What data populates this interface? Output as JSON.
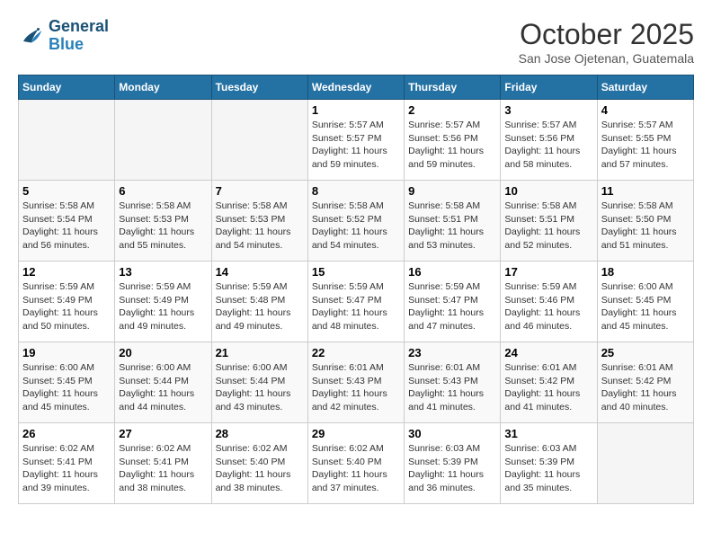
{
  "logo": {
    "line1": "General",
    "line2": "Blue"
  },
  "title": "October 2025",
  "location": "San Jose Ojetenan, Guatemala",
  "weekdays": [
    "Sunday",
    "Monday",
    "Tuesday",
    "Wednesday",
    "Thursday",
    "Friday",
    "Saturday"
  ],
  "weeks": [
    [
      {
        "day": "",
        "sunrise": "",
        "sunset": "",
        "daylight": ""
      },
      {
        "day": "",
        "sunrise": "",
        "sunset": "",
        "daylight": ""
      },
      {
        "day": "",
        "sunrise": "",
        "sunset": "",
        "daylight": ""
      },
      {
        "day": "1",
        "sunrise": "Sunrise: 5:57 AM",
        "sunset": "Sunset: 5:57 PM",
        "daylight": "Daylight: 11 hours and 59 minutes."
      },
      {
        "day": "2",
        "sunrise": "Sunrise: 5:57 AM",
        "sunset": "Sunset: 5:56 PM",
        "daylight": "Daylight: 11 hours and 59 minutes."
      },
      {
        "day": "3",
        "sunrise": "Sunrise: 5:57 AM",
        "sunset": "Sunset: 5:56 PM",
        "daylight": "Daylight: 11 hours and 58 minutes."
      },
      {
        "day": "4",
        "sunrise": "Sunrise: 5:57 AM",
        "sunset": "Sunset: 5:55 PM",
        "daylight": "Daylight: 11 hours and 57 minutes."
      }
    ],
    [
      {
        "day": "5",
        "sunrise": "Sunrise: 5:58 AM",
        "sunset": "Sunset: 5:54 PM",
        "daylight": "Daylight: 11 hours and 56 minutes."
      },
      {
        "day": "6",
        "sunrise": "Sunrise: 5:58 AM",
        "sunset": "Sunset: 5:53 PM",
        "daylight": "Daylight: 11 hours and 55 minutes."
      },
      {
        "day": "7",
        "sunrise": "Sunrise: 5:58 AM",
        "sunset": "Sunset: 5:53 PM",
        "daylight": "Daylight: 11 hours and 54 minutes."
      },
      {
        "day": "8",
        "sunrise": "Sunrise: 5:58 AM",
        "sunset": "Sunset: 5:52 PM",
        "daylight": "Daylight: 11 hours and 54 minutes."
      },
      {
        "day": "9",
        "sunrise": "Sunrise: 5:58 AM",
        "sunset": "Sunset: 5:51 PM",
        "daylight": "Daylight: 11 hours and 53 minutes."
      },
      {
        "day": "10",
        "sunrise": "Sunrise: 5:58 AM",
        "sunset": "Sunset: 5:51 PM",
        "daylight": "Daylight: 11 hours and 52 minutes."
      },
      {
        "day": "11",
        "sunrise": "Sunrise: 5:58 AM",
        "sunset": "Sunset: 5:50 PM",
        "daylight": "Daylight: 11 hours and 51 minutes."
      }
    ],
    [
      {
        "day": "12",
        "sunrise": "Sunrise: 5:59 AM",
        "sunset": "Sunset: 5:49 PM",
        "daylight": "Daylight: 11 hours and 50 minutes."
      },
      {
        "day": "13",
        "sunrise": "Sunrise: 5:59 AM",
        "sunset": "Sunset: 5:49 PM",
        "daylight": "Daylight: 11 hours and 49 minutes."
      },
      {
        "day": "14",
        "sunrise": "Sunrise: 5:59 AM",
        "sunset": "Sunset: 5:48 PM",
        "daylight": "Daylight: 11 hours and 49 minutes."
      },
      {
        "day": "15",
        "sunrise": "Sunrise: 5:59 AM",
        "sunset": "Sunset: 5:47 PM",
        "daylight": "Daylight: 11 hours and 48 minutes."
      },
      {
        "day": "16",
        "sunrise": "Sunrise: 5:59 AM",
        "sunset": "Sunset: 5:47 PM",
        "daylight": "Daylight: 11 hours and 47 minutes."
      },
      {
        "day": "17",
        "sunrise": "Sunrise: 5:59 AM",
        "sunset": "Sunset: 5:46 PM",
        "daylight": "Daylight: 11 hours and 46 minutes."
      },
      {
        "day": "18",
        "sunrise": "Sunrise: 6:00 AM",
        "sunset": "Sunset: 5:45 PM",
        "daylight": "Daylight: 11 hours and 45 minutes."
      }
    ],
    [
      {
        "day": "19",
        "sunrise": "Sunrise: 6:00 AM",
        "sunset": "Sunset: 5:45 PM",
        "daylight": "Daylight: 11 hours and 45 minutes."
      },
      {
        "day": "20",
        "sunrise": "Sunrise: 6:00 AM",
        "sunset": "Sunset: 5:44 PM",
        "daylight": "Daylight: 11 hours and 44 minutes."
      },
      {
        "day": "21",
        "sunrise": "Sunrise: 6:00 AM",
        "sunset": "Sunset: 5:44 PM",
        "daylight": "Daylight: 11 hours and 43 minutes."
      },
      {
        "day": "22",
        "sunrise": "Sunrise: 6:01 AM",
        "sunset": "Sunset: 5:43 PM",
        "daylight": "Daylight: 11 hours and 42 minutes."
      },
      {
        "day": "23",
        "sunrise": "Sunrise: 6:01 AM",
        "sunset": "Sunset: 5:43 PM",
        "daylight": "Daylight: 11 hours and 41 minutes."
      },
      {
        "day": "24",
        "sunrise": "Sunrise: 6:01 AM",
        "sunset": "Sunset: 5:42 PM",
        "daylight": "Daylight: 11 hours and 41 minutes."
      },
      {
        "day": "25",
        "sunrise": "Sunrise: 6:01 AM",
        "sunset": "Sunset: 5:42 PM",
        "daylight": "Daylight: 11 hours and 40 minutes."
      }
    ],
    [
      {
        "day": "26",
        "sunrise": "Sunrise: 6:02 AM",
        "sunset": "Sunset: 5:41 PM",
        "daylight": "Daylight: 11 hours and 39 minutes."
      },
      {
        "day": "27",
        "sunrise": "Sunrise: 6:02 AM",
        "sunset": "Sunset: 5:41 PM",
        "daylight": "Daylight: 11 hours and 38 minutes."
      },
      {
        "day": "28",
        "sunrise": "Sunrise: 6:02 AM",
        "sunset": "Sunset: 5:40 PM",
        "daylight": "Daylight: 11 hours and 38 minutes."
      },
      {
        "day": "29",
        "sunrise": "Sunrise: 6:02 AM",
        "sunset": "Sunset: 5:40 PM",
        "daylight": "Daylight: 11 hours and 37 minutes."
      },
      {
        "day": "30",
        "sunrise": "Sunrise: 6:03 AM",
        "sunset": "Sunset: 5:39 PM",
        "daylight": "Daylight: 11 hours and 36 minutes."
      },
      {
        "day": "31",
        "sunrise": "Sunrise: 6:03 AM",
        "sunset": "Sunset: 5:39 PM",
        "daylight": "Daylight: 11 hours and 35 minutes."
      },
      {
        "day": "",
        "sunrise": "",
        "sunset": "",
        "daylight": ""
      }
    ]
  ]
}
